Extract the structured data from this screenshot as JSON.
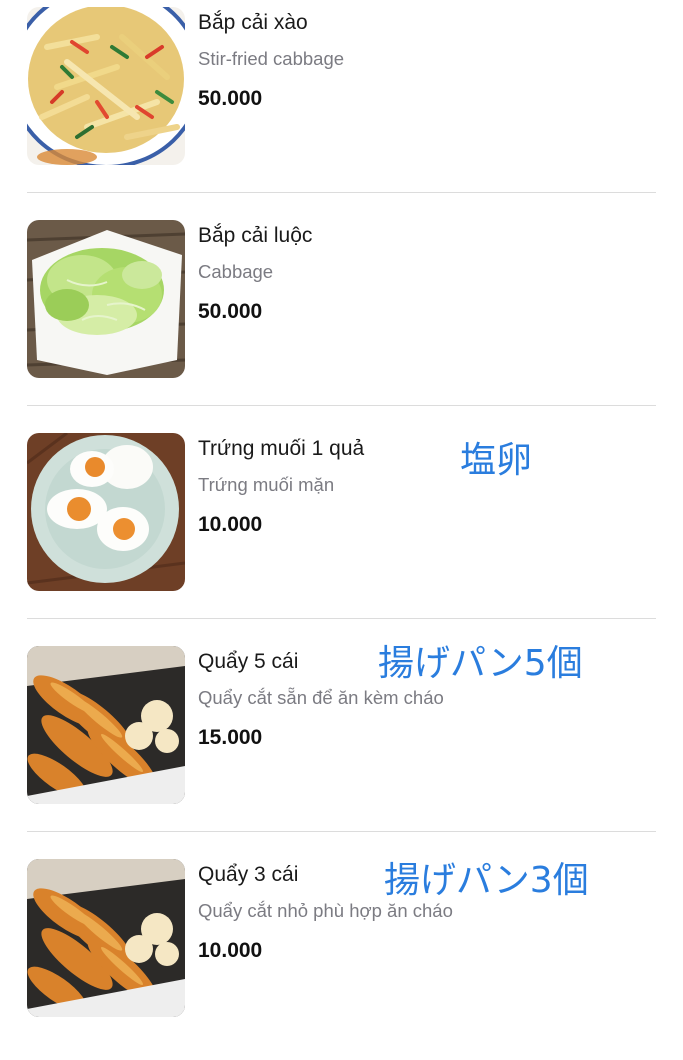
{
  "items": [
    {
      "name": "Bắp cải xào",
      "description": "Stir-fried cabbage",
      "price": "50.000",
      "note": "",
      "image": "stir-fried-cabbage-photo"
    },
    {
      "name": "Bắp cải luộc",
      "description": "Cabbage",
      "price": "50.000",
      "note": "",
      "image": "boiled-cabbage-photo"
    },
    {
      "name": "Trứng muối 1 quả",
      "description": "Trứng muối mặn",
      "price": "10.000",
      "note": "塩卵",
      "image": "salted-egg-photo"
    },
    {
      "name": "Quẩy 5 cái",
      "description": "Quẩy cắt sẵn để ăn kèm cháo",
      "price": "15.000",
      "note": "揚げパン5個",
      "image": "fried-dough-photo"
    },
    {
      "name": "Quẩy 3 cái",
      "description": "Quẩy cắt nhỏ phù hợp ăn cháo",
      "price": "10.000",
      "note": "揚げパン3個",
      "image": "fried-dough-photo"
    }
  ],
  "colors": {
    "annotation": "#2a7dde",
    "price": "#111111",
    "description": "#7b7b82",
    "divider": "#dcdcdc"
  }
}
